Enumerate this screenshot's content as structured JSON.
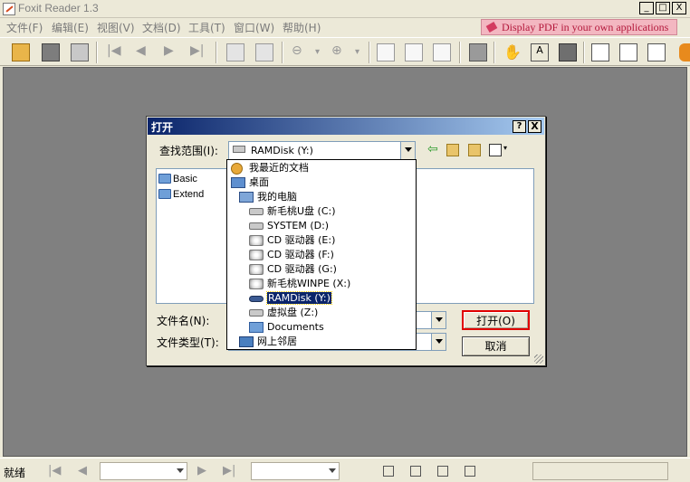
{
  "window": {
    "title": "Foxit Reader 1.3",
    "minimize": "_",
    "maximize": "□",
    "close": "X"
  },
  "menu": [
    "文件(F)",
    "编辑(E)",
    "视图(V)",
    "文档(D)",
    "工具(T)",
    "窗口(W)",
    "帮助(H)"
  ],
  "promo": "Display PDF in your own applications",
  "status": {
    "ready": "就绪"
  },
  "dialog": {
    "title": "打开",
    "help": "?",
    "close": "X",
    "look_in_label": "查找范围(I):",
    "look_in_value": "RAMDisk (Y:)",
    "files": [
      "Basic",
      "Extend"
    ],
    "filename_label": "文件名(N):",
    "filetype_label": "文件类型(T):",
    "open_button": "打开(O)",
    "cancel_button": "取消",
    "dropdown": [
      {
        "label": "我最近的文档",
        "icon": "recent-docs-icon"
      },
      {
        "label": "桌面",
        "icon": "desktop-icon"
      },
      {
        "label": "我的电脑",
        "icon": "computer-icon"
      },
      {
        "label": "新毛桃U盘 (C:)",
        "icon": "drive-icon"
      },
      {
        "label": "SYSTEM (D:)",
        "icon": "drive-icon"
      },
      {
        "label": "CD 驱动器 (E:)",
        "icon": "cd-drive-icon"
      },
      {
        "label": "CD 驱动器 (F:)",
        "icon": "cd-drive-icon"
      },
      {
        "label": "CD 驱动器 (G:)",
        "icon": "cd-drive-icon"
      },
      {
        "label": "新毛桃WINPE (X:)",
        "icon": "cd-drive-icon"
      },
      {
        "label": "RAMDisk (Y:)",
        "icon": "ramdisk-icon",
        "selected": true
      },
      {
        "label": "虚拟盘 (Z:)",
        "icon": "drive-icon"
      },
      {
        "label": "Documents",
        "icon": "folder-icon"
      },
      {
        "label": "网上邻居",
        "icon": "network-icon"
      }
    ]
  },
  "colors": {
    "accent": "#0a246a",
    "workspace": "#808080",
    "highlight_border": "#e00000"
  }
}
